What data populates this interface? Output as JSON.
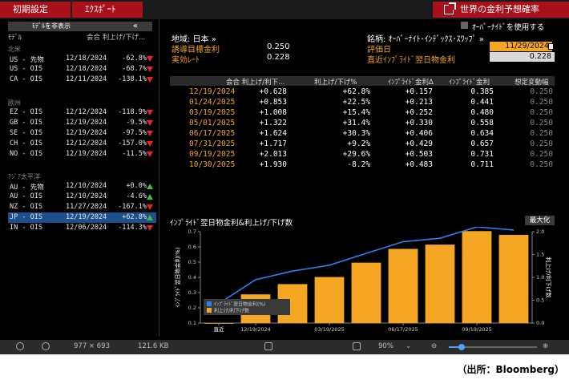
{
  "topbar": {
    "btn1": "初期設定",
    "btn2": "ｴｸｽﾎﾟｰﾄ",
    "title": "世界の金利予想確率"
  },
  "left_panel": {
    "hide_button": "ﾓﾃﾞﾙを非表示",
    "collapse_icon": "«",
    "headers": {
      "model": "ﾓﾃﾞﾙ",
      "col": "会合 利上げ/下げ..."
    },
    "sections": [
      {
        "label": "北米",
        "rows": [
          {
            "name": "US - 先物",
            "date": "12/18/2024",
            "value": "-62.8%",
            "dir": "down"
          },
          {
            "name": "US - OIS",
            "date": "12/18/2024",
            "value": "-68.7%",
            "dir": "down"
          },
          {
            "name": "CA - OIS",
            "date": "12/11/2024",
            "value": "-138.1%",
            "dir": "down"
          }
        ]
      },
      {
        "label": "欧州",
        "rows": [
          {
            "name": "EZ - OIS",
            "date": "12/12/2024",
            "value": "-118.9%",
            "dir": "down"
          },
          {
            "name": "GB - OIS",
            "date": "12/19/2024",
            "value": "-9.5%",
            "dir": "down"
          },
          {
            "name": "SE - OIS",
            "date": "12/19/2024",
            "value": "-97.5%",
            "dir": "down"
          },
          {
            "name": "CH - OIS",
            "date": "12/12/2024",
            "value": "-157.0%",
            "dir": "down"
          },
          {
            "name": "NO - OIS",
            "date": "12/19/2024",
            "value": "-11.5%",
            "dir": "down"
          }
        ]
      },
      {
        "label": "ｱｼﾞｱ太平洋",
        "rows": [
          {
            "name": "AU - 先物",
            "date": "12/10/2024",
            "value": "+0.0%",
            "dir": "up"
          },
          {
            "name": "AU - OIS",
            "date": "12/10/2024",
            "value": "-4.6%",
            "dir": "up"
          },
          {
            "name": "NZ - OIS",
            "date": "11/27/2024",
            "value": "-167.1%",
            "dir": "down"
          },
          {
            "name": "JP - OIS",
            "date": "12/19/2024",
            "value": "+62.8%",
            "dir": "up",
            "selected": true
          },
          {
            "name": "IN - OIS",
            "date": "12/06/2024",
            "value": "-114.3%",
            "dir": "down"
          }
        ]
      }
    ]
  },
  "options": {
    "overnight_label": "ｵｰﾊﾞｰﾅｲﾄﾞを使用する"
  },
  "info": {
    "region_label": "地域: 日本 »",
    "instrument_label": "銘柄: ｵｰﾊﾞｰﾅｲﾄ･ｲﾝﾃﾞｯｸｽ･ｽﾜｯﾌﾟ »",
    "target_rate_label": "誘導目標金利",
    "target_rate_value": "0.250",
    "effective_rate_label": "実効ﾚｰﾄ",
    "effective_rate_value": "0.228",
    "eval_date_label": "評価日",
    "eval_date_value": "11/29/2024",
    "implied_label": "直近ｲﾝﾌﾟﾗｲﾄﾞ翌日物金利",
    "implied_value": "0.228"
  },
  "table": {
    "headers": [
      "会合 利上げ/利下...",
      "利上げ/下げ%",
      "ｲﾝﾌﾟﾗｲﾄﾞ金利Δ",
      "ｲﾝﾌﾟﾗｲﾄﾞ金利",
      "想定変動幅"
    ],
    "rows": [
      [
        "12/19/2024",
        "+0.628",
        "+62.8%",
        "+0.157",
        "0.385",
        "0.250"
      ],
      [
        "01/24/2025",
        "+0.853",
        "+22.5%",
        "+0.213",
        "0.441",
        "0.250"
      ],
      [
        "03/19/2025",
        "+1.008",
        "+15.4%",
        "+0.252",
        "0.480",
        "0.250"
      ],
      [
        "05/01/2025",
        "+1.322",
        "+31.4%",
        "+0.330",
        "0.558",
        "0.250"
      ],
      [
        "06/17/2025",
        "+1.624",
        "+30.3%",
        "+0.406",
        "0.634",
        "0.250"
      ],
      [
        "07/31/2025",
        "+1.717",
        "+9.2%",
        "+0.429",
        "0.657",
        "0.250"
      ],
      [
        "09/19/2025",
        "+2.013",
        "+29.6%",
        "+0.503",
        "0.731",
        "0.250"
      ],
      [
        "10/30/2025",
        "+1.930",
        "-8.2%",
        "+0.483",
        "0.711",
        "0.250"
      ]
    ]
  },
  "chart_title": "ｲﾝﾌﾟﾗｲﾄﾞ翌日物金利&利上げ/下げ数",
  "maximize_label": "最大化",
  "chart_data": {
    "type": "bar",
    "categories": [
      "直近",
      "12/19/2024",
      "01/24/2025",
      "03/19/2025",
      "05/01/2025",
      "06/17/2025",
      "07/31/2025",
      "09/19/2025",
      "10/30/2025"
    ],
    "x_tick_labels": [
      "直近",
      "12/19/2024",
      "03/19/2025",
      "06/17/2025",
      "09/19/2025"
    ],
    "series": [
      {
        "name": "ｲﾝﾌﾟﾗｲﾄﾞ翌日物金利(%)",
        "type": "line",
        "axis": "left",
        "color": "#2f80ed",
        "values": [
          0.228,
          0.385,
          0.441,
          0.48,
          0.558,
          0.634,
          0.657,
          0.731,
          0.711
        ]
      },
      {
        "name": "利上げ/利下げ数",
        "type": "bar",
        "axis": "right",
        "color": "#f5a623",
        "values": [
          0.0,
          0.628,
          0.853,
          1.008,
          1.322,
          1.624,
          1.717,
          2.013,
          1.93
        ]
      }
    ],
    "ylabel": "ｲﾝﾌﾟﾗｲﾄﾞ翌日物金利(%)",
    "y2label": "利上げ/利下げ数",
    "ylim": [
      0.1,
      0.7
    ],
    "y2lim": [
      0.0,
      2.0
    ],
    "yticks": [
      "0.1",
      "0.2",
      "0.3",
      "0.4",
      "0.5",
      "0.6",
      "0.7"
    ],
    "y2ticks": [
      "0.0",
      "0.5",
      "1.0",
      "1.5",
      "2.0"
    ],
    "legend_position": "bottom-left"
  },
  "status": {
    "size": "977 × 693",
    "filesize": "121.6 KB",
    "zoom": "90%"
  },
  "source_note": "（出所：Bloomberg）"
}
